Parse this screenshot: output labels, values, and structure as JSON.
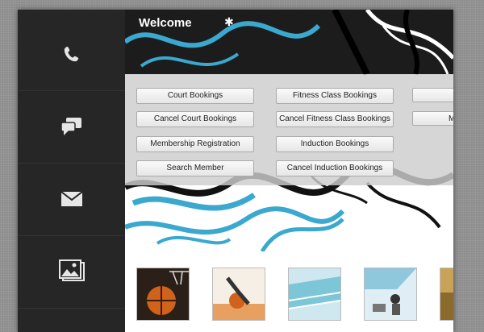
{
  "sidebar": {
    "items": [
      {
        "icon": "phone-icon"
      },
      {
        "icon": "chat-icon"
      },
      {
        "icon": "mail-icon"
      },
      {
        "icon": "gallery-icon"
      }
    ]
  },
  "header": {
    "title": "Welcome"
  },
  "menu": {
    "col1": [
      "Court Bookings",
      "Cancel Court Bookings",
      "Membership Registration",
      "Search Member"
    ],
    "col2": [
      "Fitness Class Bookings",
      "Cancel Fitness Class Bookings",
      "Induction Bookings",
      "Cancel Induction Bookings"
    ],
    "col3_partial": [
      "",
      "M",
      "",
      ""
    ]
  },
  "thumbnails": [
    {
      "icon": "basketball-image"
    },
    {
      "icon": "athlete-image"
    },
    {
      "icon": "swimming-pool-image"
    },
    {
      "icon": "gym-image"
    },
    {
      "icon": "partial-image"
    }
  ],
  "colors": {
    "accent": "#3aa8cf",
    "sidebar": "#262626",
    "panel": "#cdcdcd"
  }
}
